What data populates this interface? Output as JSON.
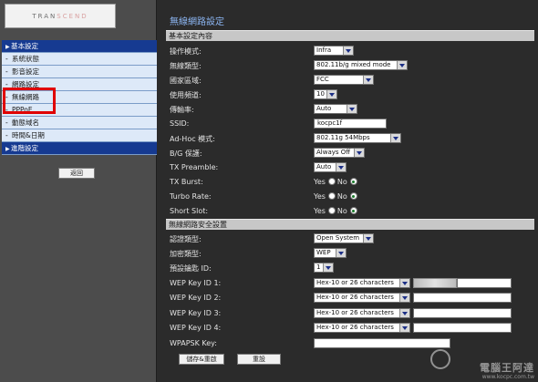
{
  "logo": {
    "text_a": "TRAN",
    "text_b": "SCEND"
  },
  "sidebar": {
    "items": [
      {
        "label": "基本設定",
        "type": "header"
      },
      {
        "label": "系統狀態",
        "type": "sub"
      },
      {
        "label": "影音設定",
        "type": "sub"
      },
      {
        "label": "網路設定",
        "type": "sub"
      },
      {
        "label": "無線網路",
        "type": "sub"
      },
      {
        "label": "PPPoE",
        "type": "sub"
      },
      {
        "label": "動態域名",
        "type": "sub"
      },
      {
        "label": "時間&日期",
        "type": "sub"
      },
      {
        "label": "進階設定",
        "type": "header"
      }
    ],
    "back_label": "返回"
  },
  "main": {
    "title": "無線網路設定",
    "section_basic": "基本設定內容",
    "section_security": "無線網路安全設置",
    "fields": {
      "op_mode": {
        "label": "操作模式:",
        "value": "Infra"
      },
      "wireless_type": {
        "label": "無線類型:",
        "value": "802.11b/g mixed mode"
      },
      "region": {
        "label": "國家區域:",
        "value": "FCC"
      },
      "channel": {
        "label": "使用頻道:",
        "value": "10"
      },
      "rate": {
        "label": "傳輸率:",
        "value": "Auto"
      },
      "ssid": {
        "label": "SSID:",
        "value": "kocpc1f"
      },
      "adhoc_mode": {
        "label": "Ad-Hoc 模式:",
        "value": "802.11g 54Mbps"
      },
      "bg_protect": {
        "label": "B/G 保護:",
        "value": "Always Off"
      },
      "tx_preamble": {
        "label": "TX Preamble:",
        "value": "Auto"
      },
      "tx_burst": {
        "label": "TX Burst:"
      },
      "turbo_rate": {
        "label": "Turbo Rate:"
      },
      "short_slot": {
        "label": "Short Slot:"
      },
      "auth_type": {
        "label": "認證類型:",
        "value": "Open System"
      },
      "encrypt_type": {
        "label": "加密類型:",
        "value": "WEP"
      },
      "default_key": {
        "label": "預設鑰匙 ID:",
        "value": "1"
      },
      "wep_key_1": {
        "label": "WEP Key ID 1:",
        "format": "Hex-10 or 26 characters"
      },
      "wep_key_2": {
        "label": "WEP Key ID 2:",
        "format": "Hex-10 or 26 characters"
      },
      "wep_key_3": {
        "label": "WEP Key ID 3:",
        "format": "Hex-10 or 26 characters"
      },
      "wep_key_4": {
        "label": "WEP Key ID 4:",
        "format": "Hex-10 or 26 characters"
      },
      "wpapsk_key": {
        "label": "WPAPSK Key:",
        "value": ""
      }
    },
    "radio": {
      "yes": "Yes",
      "no": "No"
    },
    "buttons": {
      "save_restart": "儲存&重啟",
      "reset": "重設"
    }
  },
  "watermark": {
    "text": "電腦王阿達",
    "sub": "www.kocpc.com.tw"
  },
  "colors": {
    "sidebar_header": "#163a91",
    "sidebar_item": "#dde9f8",
    "title": "#8bb4f0",
    "highlight": "#e00000"
  }
}
